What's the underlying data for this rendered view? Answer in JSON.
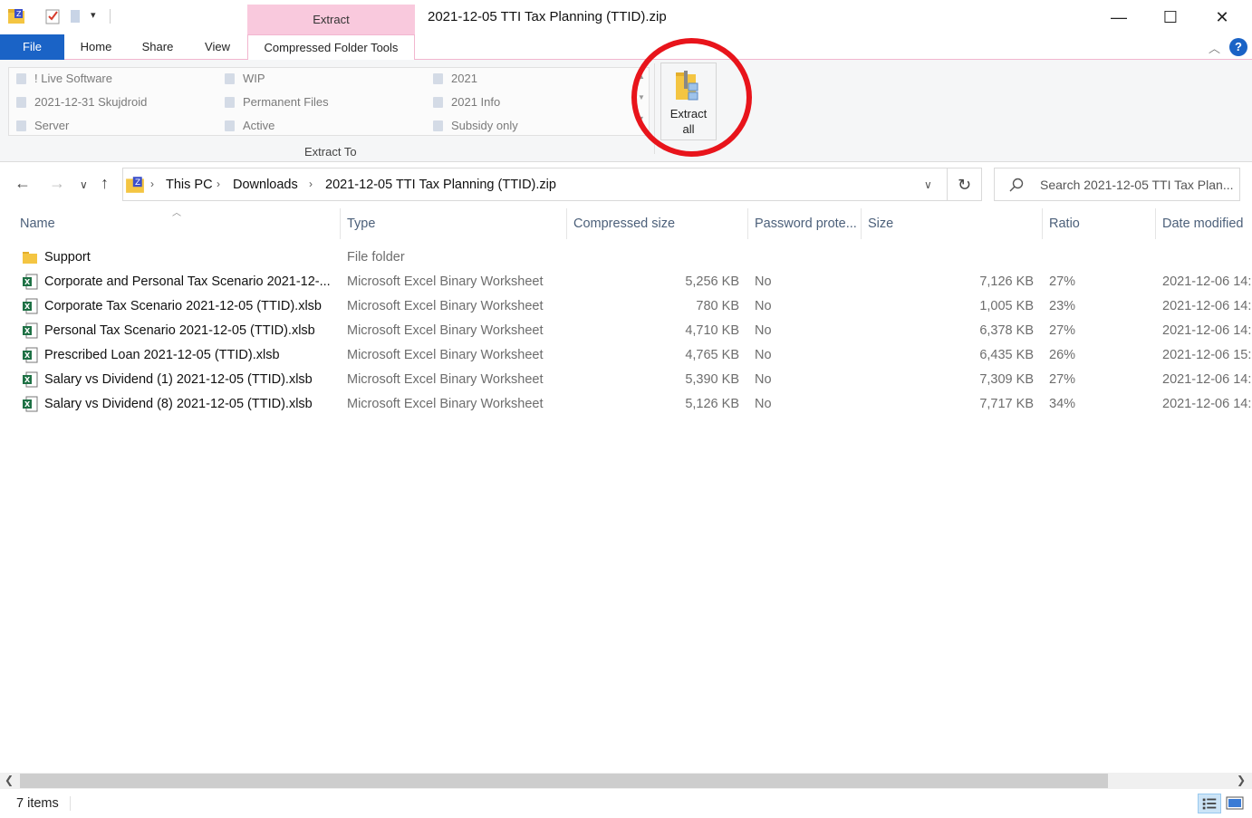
{
  "window": {
    "title": "2021-12-05 TTI Tax Planning (TTID).zip",
    "context_tab": "Extract",
    "minimize": "—",
    "maximize": "☐",
    "close": "✕"
  },
  "tabs": {
    "file": "File",
    "home": "Home",
    "share": "Share",
    "view": "View",
    "compressed": "Compressed Folder Tools"
  },
  "ribbon": {
    "gallery": [
      "! Live Software",
      "WIP",
      "2021",
      "2021-12-31 Skujdroid",
      "Permanent Files",
      "2021 Info",
      "Server",
      "Active",
      "Subsidy only"
    ],
    "extract_to_label": "Extract To",
    "extract_all_line1": "Extract",
    "extract_all_line2": "all"
  },
  "address": {
    "crumbs": [
      "This PC",
      "Downloads",
      "2021-12-05 TTI Tax Planning (TTID).zip"
    ],
    "search_placeholder": "Search 2021-12-05 TTI Tax Plan..."
  },
  "columns": [
    "Name",
    "Type",
    "Compressed size",
    "Password prote...",
    "Size",
    "Ratio",
    "Date modified"
  ],
  "files": [
    {
      "name": "Support",
      "type": "File folder",
      "csize": "",
      "pw": "",
      "size": "",
      "ratio": "",
      "date": "",
      "kind": "folder"
    },
    {
      "name": "Corporate and Personal Tax Scenario 2021-12-...",
      "type": "Microsoft Excel Binary Worksheet",
      "csize": "5,256 KB",
      "pw": "No",
      "size": "7,126 KB",
      "ratio": "27%",
      "date": "2021-12-06 14:",
      "kind": "excel"
    },
    {
      "name": "Corporate Tax Scenario 2021-12-05 (TTID).xlsb",
      "type": "Microsoft Excel Binary Worksheet",
      "csize": "780 KB",
      "pw": "No",
      "size": "1,005 KB",
      "ratio": "23%",
      "date": "2021-12-06 14:",
      "kind": "excel"
    },
    {
      "name": "Personal Tax Scenario 2021-12-05 (TTID).xlsb",
      "type": "Microsoft Excel Binary Worksheet",
      "csize": "4,710 KB",
      "pw": "No",
      "size": "6,378 KB",
      "ratio": "27%",
      "date": "2021-12-06 14:",
      "kind": "excel"
    },
    {
      "name": "Prescribed Loan 2021-12-05 (TTID).xlsb",
      "type": "Microsoft Excel Binary Worksheet",
      "csize": "4,765 KB",
      "pw": "No",
      "size": "6,435 KB",
      "ratio": "26%",
      "date": "2021-12-06 15:",
      "kind": "excel"
    },
    {
      "name": "Salary vs Dividend (1) 2021-12-05 (TTID).xlsb",
      "type": "Microsoft Excel Binary Worksheet",
      "csize": "5,390 KB",
      "pw": "No",
      "size": "7,309 KB",
      "ratio": "27%",
      "date": "2021-12-06 14:",
      "kind": "excel"
    },
    {
      "name": "Salary vs Dividend (8) 2021-12-05 (TTID).xlsb",
      "type": "Microsoft Excel Binary Worksheet",
      "csize": "5,126 KB",
      "pw": "No",
      "size": "7,717 KB",
      "ratio": "34%",
      "date": "2021-12-06 14:",
      "kind": "excel"
    }
  ],
  "status": {
    "items": "7 items"
  },
  "colors": {
    "file_tab": "#1a63c6",
    "context_tab": "#f9c9dd",
    "highlight_circle": "#e8141b",
    "excel_green": "#1e7145"
  }
}
